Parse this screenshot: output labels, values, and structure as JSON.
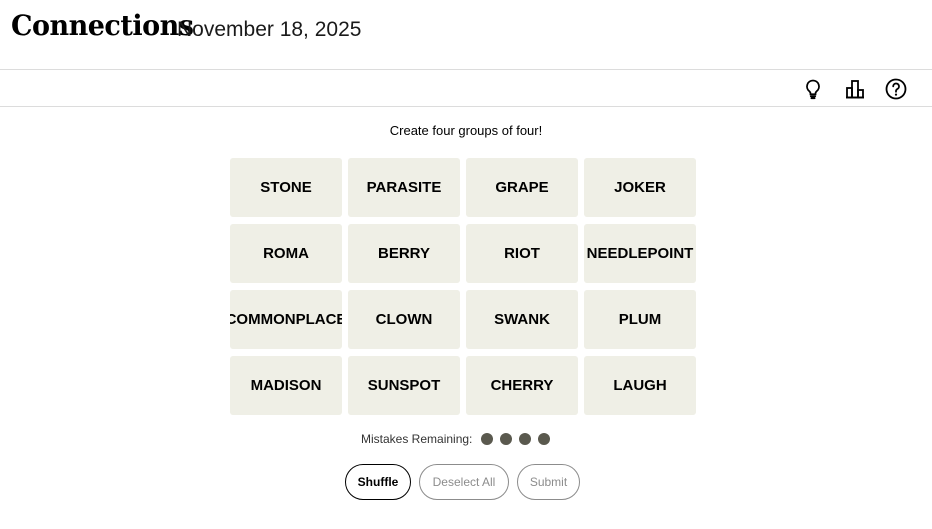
{
  "header": {
    "title": "Connections",
    "date": "November 18, 2025"
  },
  "toolbar": {
    "icons": [
      "lightbulb-icon",
      "stats-icon",
      "help-icon"
    ]
  },
  "game": {
    "instructions": "Create four groups of four!",
    "tiles": [
      "STONE",
      "PARASITE",
      "GRAPE",
      "JOKER",
      "ROMA",
      "BERRY",
      "RIOT",
      "NEEDLEPOINT",
      "COMMONPLACE",
      "CLOWN",
      "SWANK",
      "PLUM",
      "MADISON",
      "SUNSPOT",
      "CHERRY",
      "LAUGH"
    ],
    "mistakes_label": "Mistakes Remaining:",
    "mistakes_remaining": 4
  },
  "buttons": {
    "shuffle": "Shuffle",
    "deselect_all": "Deselect All",
    "submit": "Submit"
  },
  "colors": {
    "tile_bg": "#efefe6",
    "dot": "#5a594e",
    "disabled": "#8c8c8c"
  }
}
